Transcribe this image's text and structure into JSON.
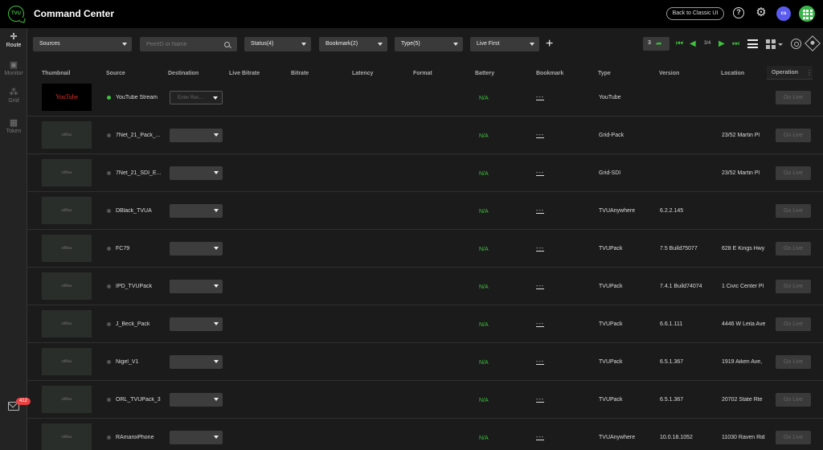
{
  "app": {
    "logo_text": "TVU",
    "title": "Command Center"
  },
  "header": {
    "classic_label": "Back to Classic UI",
    "help_icon": "?",
    "avatar_initials": "cs"
  },
  "nav": [
    {
      "label": "Route",
      "icon": "route-icon"
    },
    {
      "label": "Monitor",
      "icon": "monitor-icon"
    },
    {
      "label": "Grid",
      "icon": "grid-network-icon"
    },
    {
      "label": "Token",
      "icon": "qr-code-icon"
    }
  ],
  "notifications": {
    "count": "412"
  },
  "filters": {
    "sources": "Sources",
    "search_placeholder": "PeerID or Name",
    "status": "Status(4)",
    "bookmark": "Bookmark(2)",
    "type": "Type(5)",
    "sort": "Live First"
  },
  "pagination": {
    "go_to": "3",
    "page": "3/4"
  },
  "columns": {
    "thumbnail": "Thumbnail",
    "source": "Source",
    "destination": "Destination",
    "live_bitrate": "Live Bitrate",
    "bitrate": "Bitrate",
    "latency": "Latency",
    "format": "Format",
    "battery": "Battery",
    "bookmark": "Bookmark",
    "type": "Type",
    "version": "Version",
    "location": "Location",
    "operation": "Operation"
  },
  "rows": [
    {
      "thumb": "YouTube",
      "live": true,
      "source": "YouTube Stream",
      "dest_placeholder": "Enter Rec...",
      "battery": "N/A",
      "bookmark": "---",
      "type": "YouTube",
      "version": "",
      "location": "",
      "action": "Go Live"
    },
    {
      "thumb": "Offline",
      "live": false,
      "source": "7Net_21_Pack_...",
      "dest_placeholder": "",
      "battery": "N/A",
      "bookmark": "---",
      "type": "Grid-Pack",
      "version": "",
      "location": "23/52 Martin Pl",
      "action": "Go Live"
    },
    {
      "thumb": "Offline",
      "live": false,
      "source": "7Net_21_SDI_E...",
      "dest_placeholder": "",
      "battery": "N/A",
      "bookmark": "---",
      "type": "Grid-SDI",
      "version": "",
      "location": "23/52 Martin Pl",
      "action": "Go Live"
    },
    {
      "thumb": "Offline",
      "live": false,
      "source": "DBlack_TVUA",
      "dest_placeholder": "",
      "battery": "N/A",
      "bookmark": "---",
      "type": "TVUAnywhere",
      "version": "6.2.2.145",
      "location": "",
      "action": "Go Live"
    },
    {
      "thumb": "Offline",
      "live": false,
      "source": "FC79",
      "dest_placeholder": "",
      "battery": "N/A",
      "bookmark": "---",
      "type": "TVUPack",
      "version": "7.5 Build75077",
      "location": "628 E Kings Hwy",
      "action": "Go Live"
    },
    {
      "thumb": "Offline",
      "live": false,
      "source": "IPD_TVUPack",
      "dest_placeholder": "",
      "battery": "N/A",
      "bookmark": "---",
      "type": "TVUPack",
      "version": "7.4.1 Build74074",
      "location": "1 Civic Center Pl",
      "action": "Go Live"
    },
    {
      "thumb": "Offline",
      "live": false,
      "source": "J_Beck_Pack",
      "dest_placeholder": "",
      "battery": "N/A",
      "bookmark": "---",
      "type": "TVUPack",
      "version": "6.6.1.111",
      "location": "4446 W Leila Ave",
      "action": "Go Live"
    },
    {
      "thumb": "Offline",
      "live": false,
      "source": "Nigel_V1",
      "dest_placeholder": "",
      "battery": "N/A",
      "bookmark": "---",
      "type": "TVUPack",
      "version": "6.5.1.367",
      "location": "1919 Aiken Ave,",
      "action": "Go Live"
    },
    {
      "thumb": "Offline",
      "live": false,
      "source": "ORL_TVUPack_3",
      "dest_placeholder": "",
      "battery": "N/A",
      "bookmark": "---",
      "type": "TVUPack",
      "version": "6.5.1.367",
      "location": "20702 State Rte",
      "action": "Go Live"
    },
    {
      "thumb": "Offline",
      "live": false,
      "source": "RAmaroiPhone",
      "dest_placeholder": "",
      "battery": "N/A",
      "bookmark": "---",
      "type": "TVUAnywhere",
      "version": "10.0.18.1052",
      "location": "11030 Raven Rid",
      "action": "Go Live"
    }
  ]
}
